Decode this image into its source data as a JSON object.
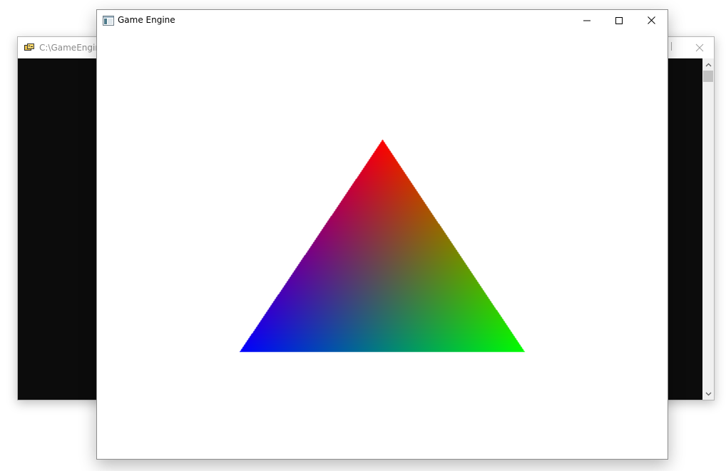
{
  "console_window": {
    "title": "C:\\GameEngine",
    "app_icon": "console-app-icon",
    "close_icon": "close-icon",
    "scroll_up_icon": "chevron-up-icon",
    "scroll_down_icon": "chevron-down-icon",
    "background_color": "#0c0c0c"
  },
  "game_window": {
    "title": "Game Engine",
    "app_icon": "window-app-icon",
    "minimize_icon": "minimize-icon",
    "maximize_icon": "maximize-icon",
    "close_icon": "close-icon",
    "render": {
      "shape": "triangle",
      "vertex_colors": {
        "top": "#ff0000",
        "bottom_left": "#0000ff",
        "bottom_right": "#00ff00"
      }
    }
  }
}
